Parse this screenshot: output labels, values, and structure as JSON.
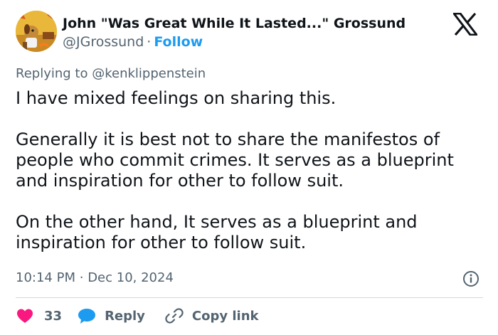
{
  "author": {
    "name": "John \"Was Great While It Lasted...\" Grossund",
    "handle": "@JGrossund",
    "separator": "·",
    "follow_label": "Follow",
    "avatar_icon": "this-is-fine-dog-avatar-icon"
  },
  "brand": {
    "icon": "x-logo-icon"
  },
  "reply": {
    "prefix": "Replying to",
    "mention": "@kenklippenstein"
  },
  "tweet": {
    "paragraphs": [
      [
        "I have mixed feelings on sharing this."
      ],
      [
        "Generally it is best not to share the manifestos of",
        "people who commit crimes. It serves as a blueprint",
        "and inspiration for other to follow suit."
      ],
      [
        "On the other hand, It serves as a blueprint and",
        "inspiration for other to follow suit."
      ]
    ]
  },
  "meta": {
    "time": "10:14 PM",
    "separator": "·",
    "date": "Dec 10, 2024",
    "info_icon": "info-icon"
  },
  "actions": {
    "like_count": "33",
    "like_icon": "heart-icon",
    "reply_label": "Reply",
    "reply_icon": "speech-bubble-icon",
    "copy_label": "Copy link",
    "copy_icon": "link-icon"
  },
  "colors": {
    "accent": "#1d9bf0",
    "like": "#f91880",
    "muted": "#536471",
    "text": "#0f1419"
  }
}
